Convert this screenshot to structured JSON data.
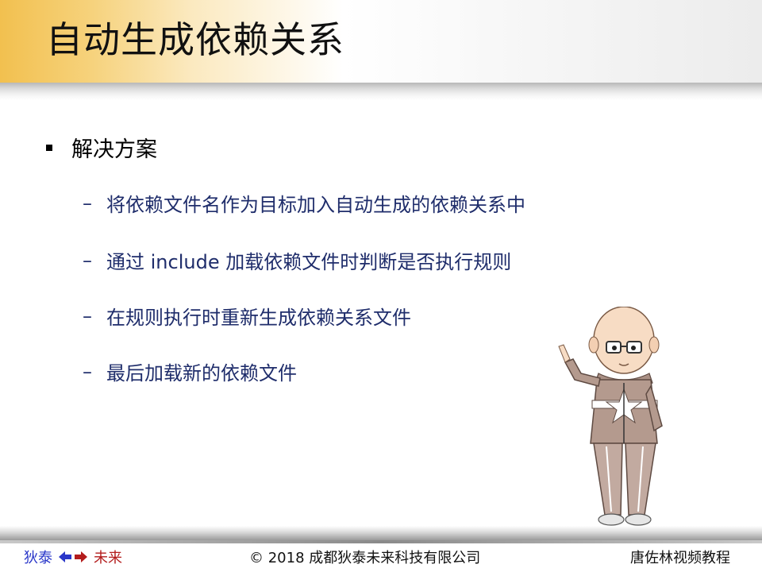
{
  "slide": {
    "title": "自动生成依赖关系",
    "bullet": "解决方案",
    "sub_items": [
      "将依赖文件名作为目标加入自动生成的依赖关系中",
      "通过 include 加载依赖文件时判断是否执行规则",
      "在规则执行时重新生成依赖关系文件",
      "最后加载新的依赖文件"
    ],
    "dash": "–"
  },
  "footer": {
    "left_a": "狄泰",
    "left_b": "未来",
    "center": "© 2018 成都狄泰未来科技有限公司",
    "right": "唐佐林视频教程"
  },
  "colors": {
    "title_gold": "#f2c04f",
    "sub_text": "#1f2d6b",
    "footer_blue": "#2a37c9",
    "footer_red": "#b31c1c"
  },
  "icons": {
    "arrows": "double-arrow-icon",
    "mascot": "cartoon-character-illustration"
  }
}
